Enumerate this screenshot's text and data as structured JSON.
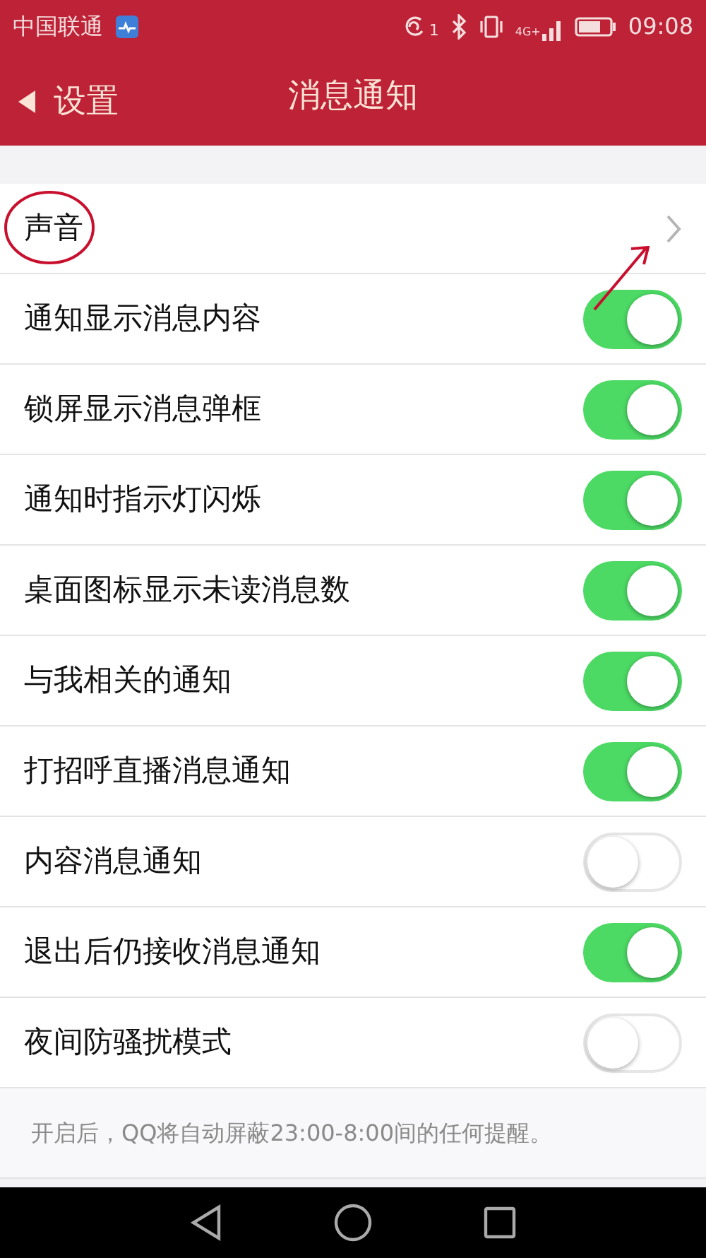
{
  "status_bar": {
    "carrier": "中国联通",
    "sim_number": "1",
    "network": "4G+",
    "time": "09:08"
  },
  "header": {
    "back_label": "设置",
    "title": "消息通知"
  },
  "settings": [
    {
      "kind": "link",
      "label": "声音",
      "annotated": true
    },
    {
      "kind": "toggle",
      "label": "通知显示消息内容",
      "on": true
    },
    {
      "kind": "toggle",
      "label": "锁屏显示消息弹框",
      "on": true
    },
    {
      "kind": "toggle",
      "label": "通知时指示灯闪烁",
      "on": true
    },
    {
      "kind": "toggle",
      "label": "桌面图标显示未读消息数",
      "on": true
    },
    {
      "kind": "toggle",
      "label": "与我相关的通知",
      "on": true
    },
    {
      "kind": "toggle",
      "label": "打招呼直播消息通知",
      "on": true
    },
    {
      "kind": "toggle",
      "label": "内容消息通知",
      "on": false
    },
    {
      "kind": "toggle",
      "label": "退出后仍接收消息通知",
      "on": true
    },
    {
      "kind": "toggle",
      "label": "夜间防骚扰模式",
      "on": false
    }
  ],
  "footnote": "开启后，QQ将自动屏蔽23:00-8:00间的任何提醒。"
}
